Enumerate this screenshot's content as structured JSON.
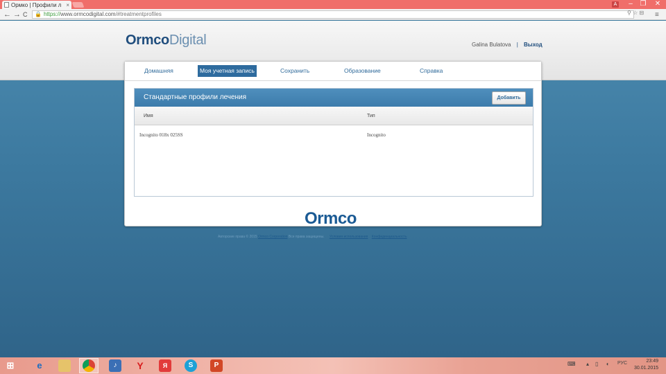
{
  "browser": {
    "tab_title": "Ормко | Профили л",
    "tab_close": "×",
    "url_scheme": "https://",
    "url_host": "www.ormcodigital.com",
    "url_path": "/#treatmentprofiles",
    "nav_back": "←",
    "nav_forward": "→",
    "nav_reload": "C",
    "win_min": "–",
    "win_max": "❐",
    "win_close": "✕",
    "user_badge": "A",
    "menu_icon": "≡",
    "omni_icons": "⚲ ☆ ⊟"
  },
  "header": {
    "logo_part1": "Ormco",
    "logo_part2": "Digital",
    "user_name": "Galina Bulatova",
    "separator": "|",
    "logout": "Выход"
  },
  "nav": {
    "items": [
      "Домашняя",
      "Моя учетная запись",
      "Сохранить",
      "Образование",
      "Справка"
    ],
    "active_index": 1
  },
  "card": {
    "title": "Стандартные профили лечения",
    "add_button": "Добавить",
    "columns": [
      "Имя",
      "Тип"
    ],
    "rows": [
      [
        "Incognito 018x 025SS",
        "Incognito"
      ]
    ]
  },
  "footer": {
    "logo": "Ormco",
    "copyright": "Авторские права © 2015",
    "link_terms": "Ormco Corporation",
    "rights": "Все права защищены.",
    "link_use": "Условия использования",
    "link_privacy": "Конфиденциальность"
  },
  "taskbar": {
    "lang": "РУС",
    "time": "23:49",
    "date": "30.01.2015"
  },
  "colors": {
    "accent": "#2e6b9e",
    "titlebar": "#f06e6a",
    "page_bg": "#3f7ea3"
  }
}
